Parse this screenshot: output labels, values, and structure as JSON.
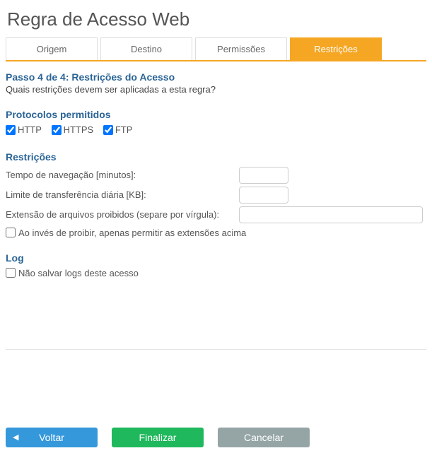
{
  "pageTitle": "Regra de Acesso Web",
  "tabs": {
    "origem": "Origem",
    "destino": "Destino",
    "permissoes": "Permissões",
    "restricoes": "Restrições"
  },
  "step": {
    "title": "Passo 4 de 4: Restrições do Acesso",
    "desc": "Quais restrições devem ser aplicadas a esta regra?"
  },
  "protocols": {
    "title": "Protocolos permitidos",
    "http": "HTTP",
    "https": "HTTPS",
    "ftp": "FTP"
  },
  "restrictions": {
    "title": "Restrições",
    "navTimeLabel": "Tempo de navegação [minutos]:",
    "navTimeValue": "",
    "dailyLimitLabel": "Limite de transferência diária [KB]:",
    "dailyLimitValue": "",
    "forbiddenExtLabel": "Extensão de arquivos proibidos (separe por vírgula):",
    "forbiddenExtValue": "",
    "invertLabel": "Ao invés de proibir, apenas permitir as extensões acima"
  },
  "log": {
    "title": "Log",
    "noLogLabel": "Não salvar logs deste acesso"
  },
  "buttons": {
    "back": "Voltar",
    "finish": "Finalizar",
    "cancel": "Cancelar"
  }
}
